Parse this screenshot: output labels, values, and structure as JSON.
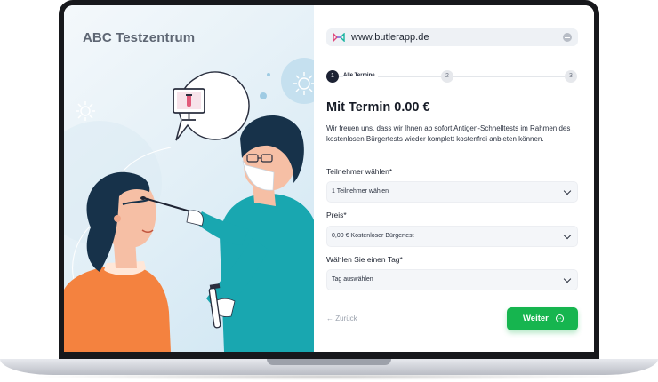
{
  "brand": "ABC Testzentrum",
  "url": "www.butlerapp.de",
  "steps": [
    {
      "number": "1",
      "label": "Alle Termine"
    },
    {
      "number": "2"
    },
    {
      "number": "3"
    }
  ],
  "title": "Mit Termin 0.00 €",
  "description": "Wir freuen uns, dass wir Ihnen ab sofort Antigen-Schnelltests im Rahmen des kostenlosen Bürgertests wieder komplett kostenfrei anbieten können.",
  "fields": {
    "participants": {
      "label": "Teilnehmer wählen*",
      "value": "1 Teilnehmer wählen"
    },
    "price": {
      "label": "Preis*",
      "value": "0,00 € Kostenloser Bürgertest"
    },
    "day": {
      "label": "Wählen Sie einen Tag*",
      "value": "Tag auswählen"
    }
  },
  "back_label": "← Zurück",
  "next_label": "Weiter",
  "colors": {
    "accent": "#16b54f",
    "dark": "#1c2233",
    "brand_text": "#5e6673"
  }
}
